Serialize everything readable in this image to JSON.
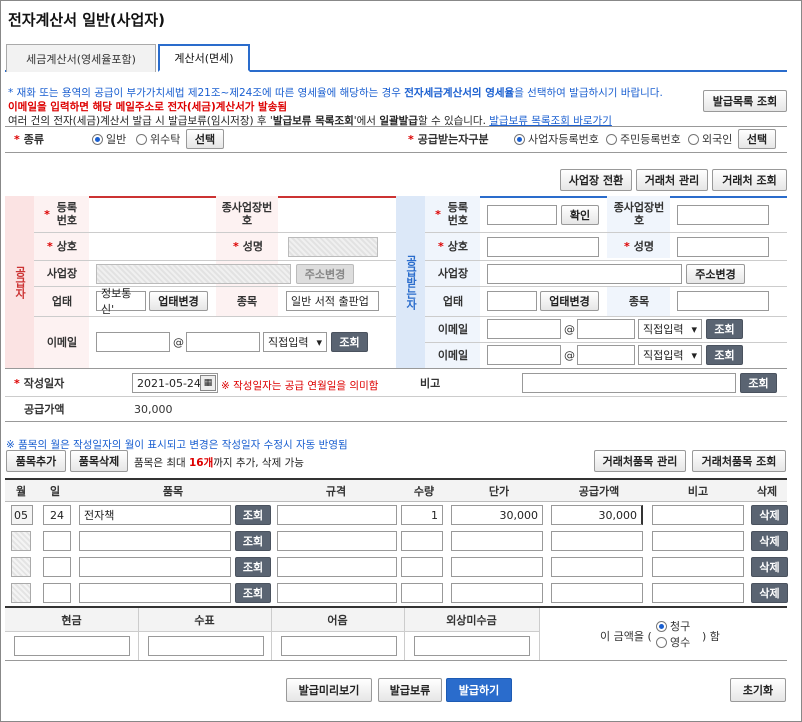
{
  "title": "전자계산서 일반(사업자)",
  "tabs": [
    "세금계산서(영세율포함)",
    "계산서(면세)"
  ],
  "notice": {
    "line1_a": "* 재화 또는 용역의 공급이 부가가치세법 제21조~제24조에 따른 영세율에 해당하는 경우 ",
    "line1_b": "전자세금계산서의 영세율",
    "line1_c": "을 선택하여 발급하시기 바랍니다.",
    "line2": "이메일을 입력하면 해당 메일주소로 전자(세금)계산서가 발송됨",
    "line3_a": "여러 건의 전자(세금)계산서 발급 시 발급보류(임시저장) 후 '",
    "line3_b": "발급보류 목록조회",
    "line3_c": "'에서 ",
    "line3_d": "일괄발급",
    "line3_e": "할 수 있습니다. ",
    "line3_link": "발급보류 목록조회 바로가기",
    "list_button": "발급목록 조회"
  },
  "kind": {
    "label": "종류",
    "opt1": "일반",
    "opt2": "위수탁",
    "select": "선택"
  },
  "receiver_type": {
    "label": "공급받는자구분",
    "opt1": "사업자등록번호",
    "opt2": "주민등록번호",
    "opt3": "외국인",
    "select": "선택"
  },
  "top_buttons": [
    "사업장 전환",
    "거래처 관리",
    "거래처 조회"
  ],
  "supplier": {
    "side_label": "공급자",
    "reg_no": "등록번호",
    "sub_no": "종사업장번호",
    "name": "상호",
    "ceo": "성명",
    "addr": "사업장",
    "addr_btn": "주소변경",
    "biz_type": "업태",
    "biz_type_val": "정보통신'",
    "biz_type_btn": "업태변경",
    "item": "종목",
    "item_val": "일반 서적 출판업",
    "email": "이메일",
    "email_at": "@",
    "email_sel": "직접입력",
    "email_btn": "조회"
  },
  "receiver": {
    "side_label": "공급받는자",
    "reg_no": "등록번호",
    "confirm": "확인",
    "sub_no": "종사업장번호",
    "name": "상호",
    "ceo": "성명",
    "addr": "사업장",
    "addr_btn": "주소변경",
    "biz_type": "업태",
    "biz_type_btn": "업태변경",
    "item": "종목",
    "email": "이메일",
    "email_at": "@",
    "email_sel": "직접입력",
    "email_btn": "조회"
  },
  "date": {
    "label": "작성일자",
    "value": "2021-05-24",
    "cal_icon": "calendar-icon",
    "note": "※ 작성일자는 공급 연월일을 의미함",
    "memo_label": "비고",
    "memo_btn": "조회"
  },
  "supply": {
    "label": "공급가액",
    "value": "30,000"
  },
  "items_note": "※ 품목의 월은 작성일자의 월이 표시되고 변경은 작성일자 수정시 자동 반영됨",
  "items_toolbar": {
    "add": "품목추가",
    "del": "품목삭제",
    "info_a": "품목은 최대 ",
    "info_b": "16개",
    "info_c": "까지 추가, 삭제 가능",
    "manage": "거래처품목 관리",
    "lookup": "거래처품목 조회"
  },
  "table": {
    "headers": [
      "월",
      "일",
      "품목",
      "규격",
      "수량",
      "단가",
      "공급가액",
      "비고",
      "삭제"
    ],
    "rows": [
      {
        "month": "05",
        "day": "24",
        "item": "전자책",
        "spec": "",
        "qty": "1",
        "price": "30,000",
        "amount": "30,000",
        "memo": ""
      },
      {
        "month": "",
        "day": "",
        "item": "",
        "spec": "",
        "qty": "",
        "price": "",
        "amount": "",
        "memo": ""
      },
      {
        "month": "",
        "day": "",
        "item": "",
        "spec": "",
        "qty": "",
        "price": "",
        "amount": "",
        "memo": ""
      },
      {
        "month": "",
        "day": "",
        "item": "",
        "spec": "",
        "qty": "",
        "price": "",
        "amount": "",
        "memo": ""
      }
    ],
    "lookup_btn": "조회",
    "delete_btn": "삭제"
  },
  "payment": {
    "headers": [
      "현금",
      "수표",
      "어음",
      "외상미수금"
    ],
    "claim_prefix": "이 금액을 (",
    "claim_opt1": "청구",
    "claim_opt2": "영수",
    "claim_suffix": ") 함"
  },
  "footer": {
    "preview": "발급미리보기",
    "hold": "발급보류",
    "issue": "발급하기",
    "reset": "초기화"
  }
}
